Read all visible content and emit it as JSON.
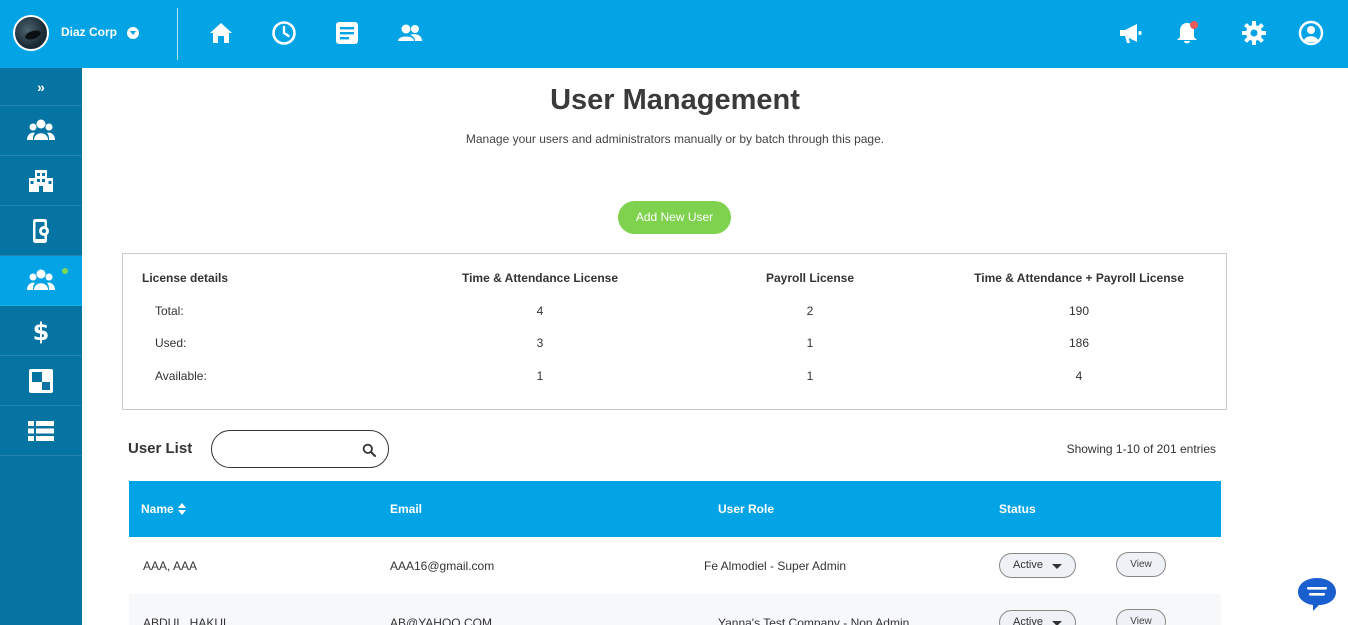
{
  "header": {
    "company_name": "Diaz Corp",
    "nav_icons": [
      "home-icon",
      "clock-icon",
      "document-icon",
      "users-icon"
    ],
    "right_icons": [
      "megaphone-icon",
      "bell-icon",
      "gear-icon",
      "account-icon"
    ],
    "accent": "#03a4e6"
  },
  "sidebar": {
    "toggle": "»",
    "items": [
      {
        "icon": "group-icon"
      },
      {
        "icon": "building-icon"
      },
      {
        "icon": "mobile-settings-icon"
      },
      {
        "icon": "user-management-icon",
        "active": true
      },
      {
        "icon": "dollar-icon"
      },
      {
        "icon": "squares-icon"
      },
      {
        "icon": "list-icon"
      }
    ],
    "bg": "#0574a2"
  },
  "main": {
    "title": "User Management",
    "subtitle": "Manage your users and administrators manually or by batch through this page.",
    "add_button": "Add New User"
  },
  "license": {
    "headers": [
      "License details",
      "Time & Attendance License",
      "Payroll License",
      "Time & Attendance + Payroll License"
    ],
    "rows": [
      {
        "label": "Total:",
        "values": [
          "4",
          "2",
          "190"
        ]
      },
      {
        "label": "Used:",
        "values": [
          "3",
          "1",
          "186"
        ]
      },
      {
        "label": "Available:",
        "values": [
          "1",
          "1",
          "4"
        ]
      }
    ]
  },
  "user_list": {
    "label": "User List",
    "search_placeholder": "",
    "showing": "Showing 1-10 of 201 entries",
    "columns": [
      "Name",
      "Email",
      "User Role",
      "Status"
    ],
    "rows": [
      {
        "name": "AAA, AAA",
        "email": "AAA16@gmail.com",
        "role": "Fe Almodiel - Super Admin",
        "status": "Active",
        "action": "View"
      },
      {
        "name": "ABDUL, HAKUL",
        "email": "AB@YAHOO.COM",
        "role": "Yanna's Test Company - Non Admin",
        "status": "Active",
        "action": "View"
      }
    ]
  }
}
